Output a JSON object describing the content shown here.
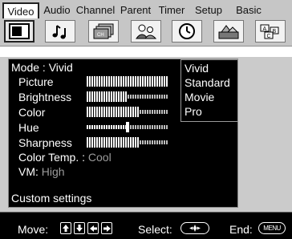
{
  "tabs": [
    {
      "label": "Video",
      "active": true
    },
    {
      "label": "Audio",
      "active": false
    },
    {
      "label": "Channel",
      "active": false
    },
    {
      "label": "Parent",
      "active": false
    },
    {
      "label": "Timer",
      "active": false
    },
    {
      "label": "Setup",
      "active": false
    },
    {
      "label": "Basic",
      "active": false
    }
  ],
  "tab_icons": [
    "video-icon",
    "audio-notes-icon",
    "channel-icon",
    "parent-icon",
    "timer-clock-icon",
    "setup-icon",
    "basic-abc-icon"
  ],
  "panel": {
    "mode_label": "Mode : Vivid",
    "settings": [
      {
        "label": "Picture",
        "level": 1.0
      },
      {
        "label": "Brightness",
        "level": 0.5
      },
      {
        "label": "Color",
        "level": 0.65
      },
      {
        "label": "Hue",
        "level": 0.5
      },
      {
        "label": "Sharpness",
        "level": 0.65
      }
    ],
    "color_temp_label": "Color Temp. :",
    "color_temp_value": "Cool",
    "vm_label": "VM:",
    "vm_value": "High",
    "custom_label": "Custom settings"
  },
  "dropdown": {
    "options": [
      "Vivid",
      "Standard",
      "Movie",
      "Pro"
    ],
    "selected": "Vivid"
  },
  "help": {
    "move_label": "Move:",
    "select_label": "Select:",
    "end_label": "End:",
    "menu_key_label": "MENU"
  },
  "colors": {
    "tab_bar": "#c6c6c6",
    "screen": "#cbcbcb",
    "panel": "#000000",
    "text": "#ffffff",
    "value_text": "#9c9c9c"
  }
}
